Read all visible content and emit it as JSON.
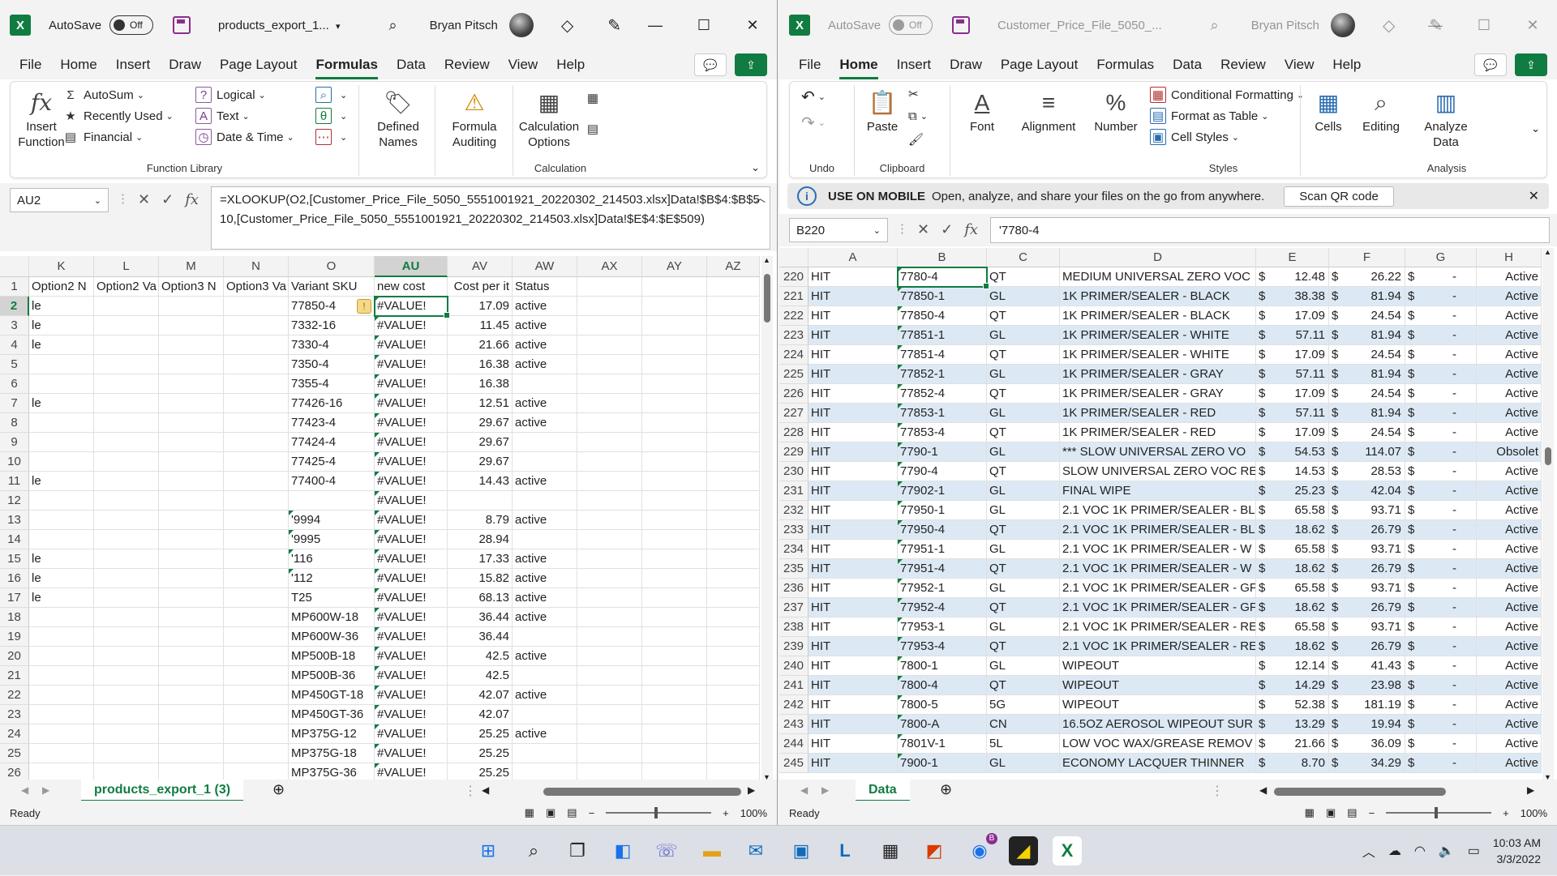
{
  "left": {
    "title": {
      "autosave": "AutoSave",
      "toggle": "Off",
      "filename": "products_export_1...",
      "user": "Bryan Pitsch"
    },
    "tabs": [
      "File",
      "Home",
      "Insert",
      "Draw",
      "Page Layout",
      "Formulas",
      "Data",
      "Review",
      "View",
      "Help"
    ],
    "active_tab": "Formulas",
    "ribbon": {
      "insert_function": "Insert Function",
      "autosum": "AutoSum",
      "recently_used": "Recently Used",
      "financial": "Financial",
      "logical": "Logical",
      "text": "Text",
      "date_time": "Date & Time",
      "defined_names": "Defined Names",
      "formula_auditing": "Formula Auditing",
      "calc_options": "Calculation Options",
      "group_function_library": "Function Library",
      "group_calculation": "Calculation"
    },
    "name_box": "AU2",
    "formula": "=XLOOKUP(O2,[Customer_Price_File_5050_5551001921_20220302_214503.xlsx]Data!$B$4:$B$510,[Customer_Price_File_5050_5551001921_20220302_214503.xlsx]Data!$E$4:$E$509)",
    "columns": [
      "K",
      "L",
      "M",
      "N",
      "O",
      "AU",
      "AV",
      "AW",
      "AX",
      "AY",
      "AZ"
    ],
    "selected_column": "AU",
    "rows": [
      {
        "n": "1",
        "k": "Option2 N",
        "l": "Option2 Va",
        "m": "Option3 N",
        "nn": "Option3 Va",
        "o": "Variant SKU",
        "au": "new cost",
        "av": "Cost per it",
        "aw": "Status"
      },
      {
        "n": "2",
        "k": "le",
        "o": "77850-4",
        "au": "#VALUE!",
        "av": "17.09",
        "aw": "active"
      },
      {
        "n": "3",
        "k": "le",
        "o": "7332-16",
        "au": "#VALUE!",
        "av": "11.45",
        "aw": "active"
      },
      {
        "n": "4",
        "k": "le",
        "o": "7330-4",
        "au": "#VALUE!",
        "av": "21.66",
        "aw": "active"
      },
      {
        "n": "5",
        "k": "",
        "o": "7350-4",
        "au": "#VALUE!",
        "av": "16.38",
        "aw": "active"
      },
      {
        "n": "6",
        "k": "",
        "o": "7355-4",
        "au": "#VALUE!",
        "av": "16.38",
        "aw": ""
      },
      {
        "n": "7",
        "k": "le",
        "o": "77426-16",
        "au": "#VALUE!",
        "av": "12.51",
        "aw": "active"
      },
      {
        "n": "8",
        "k": "",
        "o": "77423-4",
        "au": "#VALUE!",
        "av": "29.67",
        "aw": "active"
      },
      {
        "n": "9",
        "k": "",
        "o": "77424-4",
        "au": "#VALUE!",
        "av": "29.67",
        "aw": ""
      },
      {
        "n": "10",
        "k": "",
        "o": "77425-4",
        "au": "#VALUE!",
        "av": "29.67",
        "aw": ""
      },
      {
        "n": "11",
        "k": "le",
        "o": "77400-4",
        "au": "#VALUE!",
        "av": "14.43",
        "aw": "active"
      },
      {
        "n": "12",
        "k": "",
        "o": "",
        "au": "#VALUE!",
        "av": "",
        "aw": ""
      },
      {
        "n": "13",
        "k": "",
        "o": "'9994",
        "au": "#VALUE!",
        "av": "8.79",
        "aw": "active"
      },
      {
        "n": "14",
        "k": "",
        "o": "'9995",
        "au": "#VALUE!",
        "av": "28.94",
        "aw": ""
      },
      {
        "n": "15",
        "k": "le",
        "o": "'116",
        "au": "#VALUE!",
        "av": "17.33",
        "aw": "active"
      },
      {
        "n": "16",
        "k": "le",
        "o": "'112",
        "au": "#VALUE!",
        "av": "15.82",
        "aw": "active"
      },
      {
        "n": "17",
        "k": "le",
        "o": "T25",
        "au": "#VALUE!",
        "av": "68.13",
        "aw": "active"
      },
      {
        "n": "18",
        "k": "",
        "o": "MP600W-18",
        "au": "#VALUE!",
        "av": "36.44",
        "aw": "active"
      },
      {
        "n": "19",
        "k": "",
        "o": "MP600W-36",
        "au": "#VALUE!",
        "av": "36.44",
        "aw": ""
      },
      {
        "n": "20",
        "k": "",
        "o": "MP500B-18",
        "au": "#VALUE!",
        "av": "42.5",
        "aw": "active"
      },
      {
        "n": "21",
        "k": "",
        "o": "MP500B-36",
        "au": "#VALUE!",
        "av": "42.5",
        "aw": ""
      },
      {
        "n": "22",
        "k": "",
        "o": "MP450GT-18",
        "au": "#VALUE!",
        "av": "42.07",
        "aw": "active"
      },
      {
        "n": "23",
        "k": "",
        "o": "MP450GT-36",
        "au": "#VALUE!",
        "av": "42.07",
        "aw": ""
      },
      {
        "n": "24",
        "k": "",
        "o": "MP375G-12",
        "au": "#VALUE!",
        "av": "25.25",
        "aw": "active"
      },
      {
        "n": "25",
        "k": "",
        "o": "MP375G-18",
        "au": "#VALUE!",
        "av": "25.25",
        "aw": ""
      },
      {
        "n": "26",
        "k": "",
        "o": "MP375G-36",
        "au": "#VALUE!",
        "av": "25.25",
        "aw": ""
      }
    ],
    "sheet_tab": "products_export_1 (3)",
    "status": "Ready",
    "zoom": "100%"
  },
  "right": {
    "title": {
      "autosave": "AutoSave",
      "toggle": "Off",
      "filename": "Customer_Price_File_5050_...",
      "user": "Bryan Pitsch"
    },
    "tabs": [
      "File",
      "Home",
      "Insert",
      "Draw",
      "Page Layout",
      "Formulas",
      "Data",
      "Review",
      "View",
      "Help"
    ],
    "active_tab": "Home",
    "ribbon": {
      "undo": "Undo",
      "paste": "Paste",
      "clipboard": "Clipboard",
      "font": "Font",
      "alignment": "Alignment",
      "number": "Number",
      "cond_format": "Conditional Formatting",
      "format_table": "Format as Table",
      "cell_styles": "Cell Styles",
      "styles": "Styles",
      "cells": "Cells",
      "editing": "Editing",
      "analyze_data": "Analyze Data",
      "analysis": "Analysis"
    },
    "info": {
      "title": "USE ON MOBILE",
      "text": "Open, analyze, and share your files on the go from anywhere.",
      "button": "Scan QR code"
    },
    "name_box": "B220",
    "formula": "'7780-4",
    "columns": [
      "A",
      "B",
      "C",
      "D",
      "E",
      "F",
      "G",
      "H"
    ],
    "rows": [
      {
        "n": "220",
        "a": "HIT",
        "b": "7780-4",
        "c": "QT",
        "d": "MEDIUM UNIVERSAL ZERO VOC",
        "e": "12.48",
        "f": "26.22",
        "g": "-",
        "h": "Active"
      },
      {
        "n": "221",
        "a": "HIT",
        "b": "77850-1",
        "c": "GL",
        "d": "1K PRIMER/SEALER - BLACK",
        "e": "38.38",
        "f": "81.94",
        "g": "-",
        "h": "Active"
      },
      {
        "n": "222",
        "a": "HIT",
        "b": "77850-4",
        "c": "QT",
        "d": "1K PRIMER/SEALER - BLACK",
        "e": "17.09",
        "f": "24.54",
        "g": "-",
        "h": "Active"
      },
      {
        "n": "223",
        "a": "HIT",
        "b": "77851-1",
        "c": "GL",
        "d": "1K PRIMER/SEALER - WHITE",
        "e": "57.11",
        "f": "81.94",
        "g": "-",
        "h": "Active"
      },
      {
        "n": "224",
        "a": "HIT",
        "b": "77851-4",
        "c": "QT",
        "d": "1K PRIMER/SEALER - WHITE",
        "e": "17.09",
        "f": "24.54",
        "g": "-",
        "h": "Active"
      },
      {
        "n": "225",
        "a": "HIT",
        "b": "77852-1",
        "c": "GL",
        "d": "1K PRIMER/SEALER - GRAY",
        "e": "57.11",
        "f": "81.94",
        "g": "-",
        "h": "Active"
      },
      {
        "n": "226",
        "a": "HIT",
        "b": "77852-4",
        "c": "QT",
        "d": "1K PRIMER/SEALER - GRAY",
        "e": "17.09",
        "f": "24.54",
        "g": "-",
        "h": "Active"
      },
      {
        "n": "227",
        "a": "HIT",
        "b": "77853-1",
        "c": "GL",
        "d": "1K PRIMER/SEALER - RED",
        "e": "57.11",
        "f": "81.94",
        "g": "-",
        "h": "Active"
      },
      {
        "n": "228",
        "a": "HIT",
        "b": "77853-4",
        "c": "QT",
        "d": "1K PRIMER/SEALER - RED",
        "e": "17.09",
        "f": "24.54",
        "g": "-",
        "h": "Active"
      },
      {
        "n": "229",
        "a": "HIT",
        "b": "7790-1",
        "c": "GL",
        "d": "*** SLOW UNIVERSAL ZERO VO",
        "e": "54.53",
        "f": "114.07",
        "g": "-",
        "h": "Obsolet"
      },
      {
        "n": "230",
        "a": "HIT",
        "b": "7790-4",
        "c": "QT",
        "d": "SLOW UNIVERSAL ZERO VOC RE",
        "e": "14.53",
        "f": "28.53",
        "g": "-",
        "h": "Active"
      },
      {
        "n": "231",
        "a": "HIT",
        "b": "77902-1",
        "c": "GL",
        "d": "FINAL WIPE",
        "e": "25.23",
        "f": "42.04",
        "g": "-",
        "h": "Active"
      },
      {
        "n": "232",
        "a": "HIT",
        "b": "77950-1",
        "c": "GL",
        "d": "2.1 VOC 1K PRIMER/SEALER - BL",
        "e": "65.58",
        "f": "93.71",
        "g": "-",
        "h": "Active"
      },
      {
        "n": "233",
        "a": "HIT",
        "b": "77950-4",
        "c": "QT",
        "d": "2.1 VOC 1K PRIMER/SEALER - BL",
        "e": "18.62",
        "f": "26.79",
        "g": "-",
        "h": "Active"
      },
      {
        "n": "234",
        "a": "HIT",
        "b": "77951-1",
        "c": "GL",
        "d": "2.1 VOC 1K PRIMER/SEALER - W",
        "e": "65.58",
        "f": "93.71",
        "g": "-",
        "h": "Active"
      },
      {
        "n": "235",
        "a": "HIT",
        "b": "77951-4",
        "c": "QT",
        "d": "2.1 VOC 1K PRIMER/SEALER - W",
        "e": "18.62",
        "f": "26.79",
        "g": "-",
        "h": "Active"
      },
      {
        "n": "236",
        "a": "HIT",
        "b": "77952-1",
        "c": "GL",
        "d": "2.1 VOC 1K PRIMER/SEALER - GF",
        "e": "65.58",
        "f": "93.71",
        "g": "-",
        "h": "Active"
      },
      {
        "n": "237",
        "a": "HIT",
        "b": "77952-4",
        "c": "QT",
        "d": "2.1 VOC 1K PRIMER/SEALER - GF",
        "e": "18.62",
        "f": "26.79",
        "g": "-",
        "h": "Active"
      },
      {
        "n": "238",
        "a": "HIT",
        "b": "77953-1",
        "c": "GL",
        "d": "2.1 VOC 1K PRIMER/SEALER - RE",
        "e": "65.58",
        "f": "93.71",
        "g": "-",
        "h": "Active"
      },
      {
        "n": "239",
        "a": "HIT",
        "b": "77953-4",
        "c": "QT",
        "d": "2.1 VOC 1K PRIMER/SEALER - RE",
        "e": "18.62",
        "f": "26.79",
        "g": "-",
        "h": "Active"
      },
      {
        "n": "240",
        "a": "HIT",
        "b": "7800-1",
        "c": "GL",
        "d": "WIPEOUT",
        "e": "12.14",
        "f": "41.43",
        "g": "-",
        "h": "Active"
      },
      {
        "n": "241",
        "a": "HIT",
        "b": "7800-4",
        "c": "QT",
        "d": "WIPEOUT",
        "e": "14.29",
        "f": "23.98",
        "g": "-",
        "h": "Active"
      },
      {
        "n": "242",
        "a": "HIT",
        "b": "7800-5",
        "c": "5G",
        "d": "WIPEOUT",
        "e": "52.38",
        "f": "181.19",
        "g": "-",
        "h": "Active"
      },
      {
        "n": "243",
        "a": "HIT",
        "b": "7800-A",
        "c": "CN",
        "d": "16.5OZ AEROSOL WIPEOUT SUR",
        "e": "13.29",
        "f": "19.94",
        "g": "-",
        "h": "Active"
      },
      {
        "n": "244",
        "a": "HIT",
        "b": "7801V-1",
        "c": "5L",
        "d": "LOW VOC WAX/GREASE REMOV",
        "e": "21.66",
        "f": "36.09",
        "g": "-",
        "h": "Active"
      },
      {
        "n": "245",
        "a": "HIT",
        "b": "7900-1",
        "c": "GL",
        "d": "ECONOMY LACQUER THINNER",
        "e": "8.70",
        "f": "34.29",
        "g": "-",
        "h": "Active"
      }
    ],
    "currency": "$",
    "sheet_tab": "Data",
    "status": "Ready",
    "zoom": "100%"
  },
  "taskbar": {
    "time": "10:03 AM",
    "date": "3/3/2022",
    "badge": "B"
  },
  "colors": {
    "accent": "#107c41",
    "row_band": "#dce9f5",
    "excel_purple": "#8a2d8e"
  }
}
